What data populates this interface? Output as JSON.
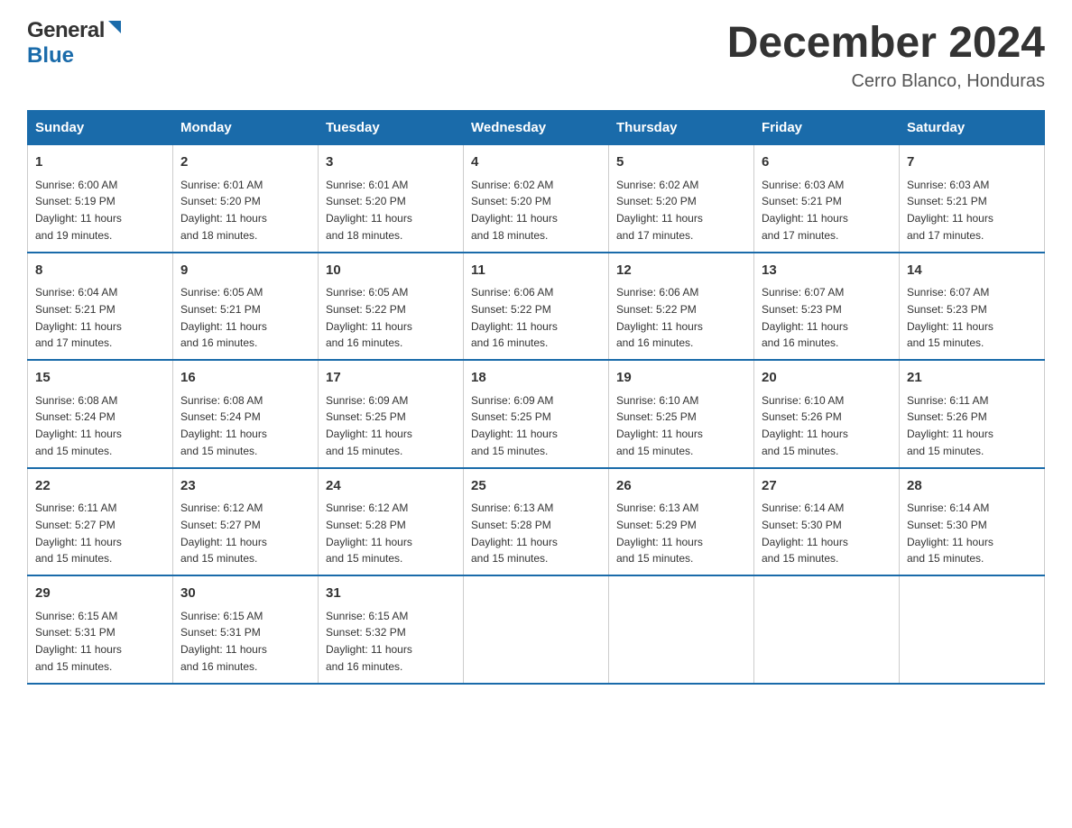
{
  "header": {
    "logo_general": "General",
    "logo_blue": "Blue",
    "month_year": "December 2024",
    "location": "Cerro Blanco, Honduras"
  },
  "days_of_week": [
    "Sunday",
    "Monday",
    "Tuesday",
    "Wednesday",
    "Thursday",
    "Friday",
    "Saturday"
  ],
  "weeks": [
    [
      {
        "day": "1",
        "sunrise": "6:00 AM",
        "sunset": "5:19 PM",
        "daylight": "11 hours and 19 minutes."
      },
      {
        "day": "2",
        "sunrise": "6:01 AM",
        "sunset": "5:20 PM",
        "daylight": "11 hours and 18 minutes."
      },
      {
        "day": "3",
        "sunrise": "6:01 AM",
        "sunset": "5:20 PM",
        "daylight": "11 hours and 18 minutes."
      },
      {
        "day": "4",
        "sunrise": "6:02 AM",
        "sunset": "5:20 PM",
        "daylight": "11 hours and 18 minutes."
      },
      {
        "day": "5",
        "sunrise": "6:02 AM",
        "sunset": "5:20 PM",
        "daylight": "11 hours and 17 minutes."
      },
      {
        "day": "6",
        "sunrise": "6:03 AM",
        "sunset": "5:21 PM",
        "daylight": "11 hours and 17 minutes."
      },
      {
        "day": "7",
        "sunrise": "6:03 AM",
        "sunset": "5:21 PM",
        "daylight": "11 hours and 17 minutes."
      }
    ],
    [
      {
        "day": "8",
        "sunrise": "6:04 AM",
        "sunset": "5:21 PM",
        "daylight": "11 hours and 17 minutes."
      },
      {
        "day": "9",
        "sunrise": "6:05 AM",
        "sunset": "5:21 PM",
        "daylight": "11 hours and 16 minutes."
      },
      {
        "day": "10",
        "sunrise": "6:05 AM",
        "sunset": "5:22 PM",
        "daylight": "11 hours and 16 minutes."
      },
      {
        "day": "11",
        "sunrise": "6:06 AM",
        "sunset": "5:22 PM",
        "daylight": "11 hours and 16 minutes."
      },
      {
        "day": "12",
        "sunrise": "6:06 AM",
        "sunset": "5:22 PM",
        "daylight": "11 hours and 16 minutes."
      },
      {
        "day": "13",
        "sunrise": "6:07 AM",
        "sunset": "5:23 PM",
        "daylight": "11 hours and 16 minutes."
      },
      {
        "day": "14",
        "sunrise": "6:07 AM",
        "sunset": "5:23 PM",
        "daylight": "11 hours and 15 minutes."
      }
    ],
    [
      {
        "day": "15",
        "sunrise": "6:08 AM",
        "sunset": "5:24 PM",
        "daylight": "11 hours and 15 minutes."
      },
      {
        "day": "16",
        "sunrise": "6:08 AM",
        "sunset": "5:24 PM",
        "daylight": "11 hours and 15 minutes."
      },
      {
        "day": "17",
        "sunrise": "6:09 AM",
        "sunset": "5:25 PM",
        "daylight": "11 hours and 15 minutes."
      },
      {
        "day": "18",
        "sunrise": "6:09 AM",
        "sunset": "5:25 PM",
        "daylight": "11 hours and 15 minutes."
      },
      {
        "day": "19",
        "sunrise": "6:10 AM",
        "sunset": "5:25 PM",
        "daylight": "11 hours and 15 minutes."
      },
      {
        "day": "20",
        "sunrise": "6:10 AM",
        "sunset": "5:26 PM",
        "daylight": "11 hours and 15 minutes."
      },
      {
        "day": "21",
        "sunrise": "6:11 AM",
        "sunset": "5:26 PM",
        "daylight": "11 hours and 15 minutes."
      }
    ],
    [
      {
        "day": "22",
        "sunrise": "6:11 AM",
        "sunset": "5:27 PM",
        "daylight": "11 hours and 15 minutes."
      },
      {
        "day": "23",
        "sunrise": "6:12 AM",
        "sunset": "5:27 PM",
        "daylight": "11 hours and 15 minutes."
      },
      {
        "day": "24",
        "sunrise": "6:12 AM",
        "sunset": "5:28 PM",
        "daylight": "11 hours and 15 minutes."
      },
      {
        "day": "25",
        "sunrise": "6:13 AM",
        "sunset": "5:28 PM",
        "daylight": "11 hours and 15 minutes."
      },
      {
        "day": "26",
        "sunrise": "6:13 AM",
        "sunset": "5:29 PM",
        "daylight": "11 hours and 15 minutes."
      },
      {
        "day": "27",
        "sunrise": "6:14 AM",
        "sunset": "5:30 PM",
        "daylight": "11 hours and 15 minutes."
      },
      {
        "day": "28",
        "sunrise": "6:14 AM",
        "sunset": "5:30 PM",
        "daylight": "11 hours and 15 minutes."
      }
    ],
    [
      {
        "day": "29",
        "sunrise": "6:15 AM",
        "sunset": "5:31 PM",
        "daylight": "11 hours and 15 minutes."
      },
      {
        "day": "30",
        "sunrise": "6:15 AM",
        "sunset": "5:31 PM",
        "daylight": "11 hours and 16 minutes."
      },
      {
        "day": "31",
        "sunrise": "6:15 AM",
        "sunset": "5:32 PM",
        "daylight": "11 hours and 16 minutes."
      },
      {
        "day": "",
        "sunrise": "",
        "sunset": "",
        "daylight": ""
      },
      {
        "day": "",
        "sunrise": "",
        "sunset": "",
        "daylight": ""
      },
      {
        "day": "",
        "sunrise": "",
        "sunset": "",
        "daylight": ""
      },
      {
        "day": "",
        "sunrise": "",
        "sunset": "",
        "daylight": ""
      }
    ]
  ]
}
